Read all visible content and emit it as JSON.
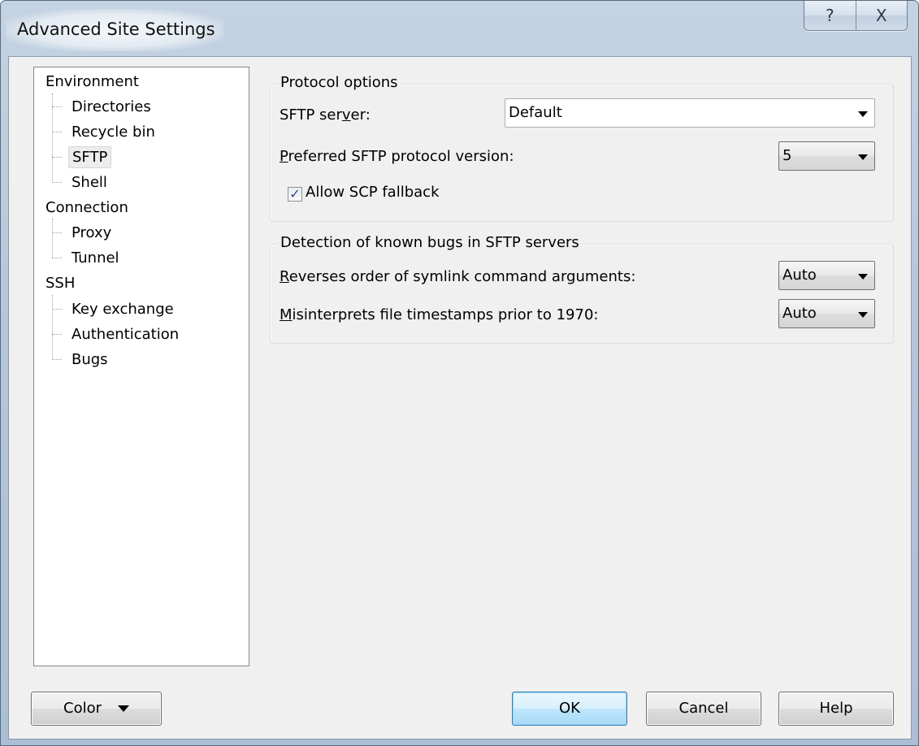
{
  "window": {
    "title": "Advanced Site Settings",
    "help_button": "?",
    "close_button": "X"
  },
  "tree": {
    "items": [
      {
        "label": "Environment",
        "level": 0
      },
      {
        "label": "Directories",
        "level": 1
      },
      {
        "label": "Recycle bin",
        "level": 1
      },
      {
        "label": "SFTP",
        "level": 1,
        "selected": true
      },
      {
        "label": "Shell",
        "level": 1
      },
      {
        "label": "Connection",
        "level": 0
      },
      {
        "label": "Proxy",
        "level": 1
      },
      {
        "label": "Tunnel",
        "level": 1
      },
      {
        "label": "SSH",
        "level": 0
      },
      {
        "label": "Key exchange",
        "level": 1
      },
      {
        "label": "Authentication",
        "level": 1
      },
      {
        "label": "Bugs",
        "level": 1
      }
    ]
  },
  "protocol_options": {
    "caption": "Protocol options",
    "sftp_server_label_pre": "SFTP ser",
    "sftp_server_label_u": "v",
    "sftp_server_label_post": "er:",
    "sftp_server_value": "Default",
    "preferred_version_label_u": "P",
    "preferred_version_label_post": "referred SFTP protocol version:",
    "preferred_version_value": "5",
    "allow_scp_fallback_label": "Allow SCP fallback",
    "allow_scp_fallback_checked": true
  },
  "bug_detection": {
    "caption": "Detection of known bugs in SFTP servers",
    "symlink_label_u": "R",
    "symlink_label_post": "everses order of symlink command arguments:",
    "symlink_value": "Auto",
    "timestamps_label_u": "M",
    "timestamps_label_post": "isinterprets file timestamps prior to 1970:",
    "timestamps_value": "Auto"
  },
  "buttons": {
    "color": "Color",
    "ok": "OK",
    "cancel": "Cancel",
    "help": "Help"
  }
}
